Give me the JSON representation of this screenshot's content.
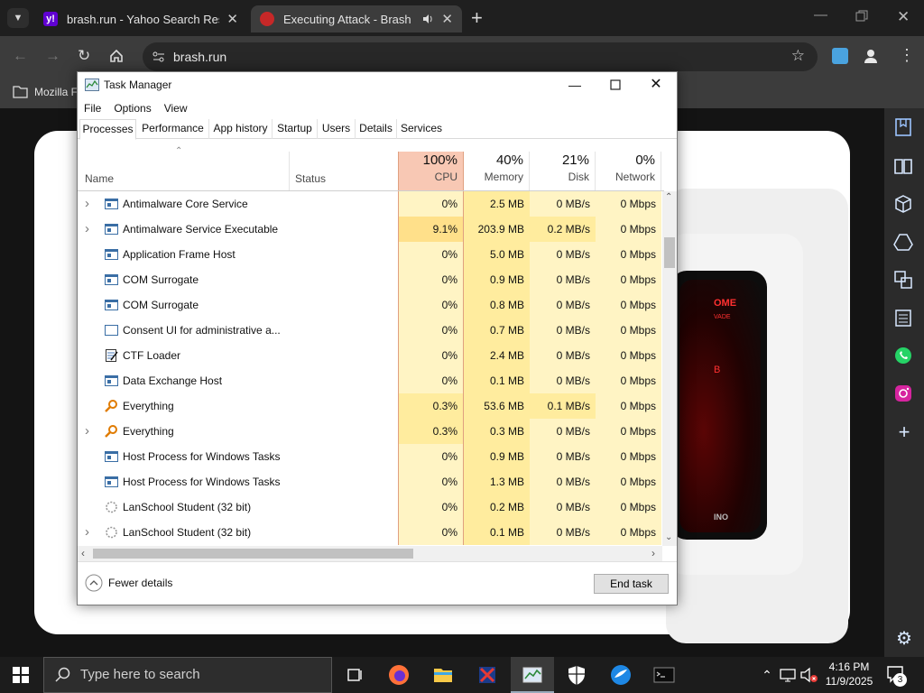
{
  "browser": {
    "tabs": [
      {
        "title": "brash.run - Yahoo Search Results",
        "close": "✕"
      },
      {
        "title": "Executing Attack - Brash",
        "close": "✕"
      }
    ],
    "new_tab": "+",
    "url": "brash.run",
    "bookmark": "Mozilla Firefox"
  },
  "phone_screen": {
    "line1": "OME",
    "line2": "VADE",
    "line3": "B",
    "footer": "INO"
  },
  "task_manager": {
    "title": "Task Manager",
    "menu": [
      "File",
      "Options",
      "View"
    ],
    "tabs": [
      "Processes",
      "Performance",
      "App history",
      "Startup",
      "Users",
      "Details",
      "Services"
    ],
    "columns": {
      "name": "Name",
      "status": "Status",
      "cpu": {
        "pct": "100%",
        "label": "CPU"
      },
      "memory": {
        "pct": "40%",
        "label": "Memory"
      },
      "disk": {
        "pct": "21%",
        "label": "Disk"
      },
      "network": {
        "pct": "0%",
        "label": "Network"
      }
    },
    "processes": [
      {
        "name": "Antimalware Core Service",
        "expandable": true,
        "icon": "window-app-icon",
        "cpu": "0%",
        "memory": "2.5 MB",
        "disk": "0 MB/s",
        "network": "0 Mbps"
      },
      {
        "name": "Antimalware Service Executable",
        "expandable": true,
        "icon": "window-app-icon",
        "cpu": "9.1%",
        "memory": "203.9 MB",
        "disk": "0.2 MB/s",
        "network": "0 Mbps"
      },
      {
        "name": "Application Frame Host",
        "expandable": false,
        "icon": "window-app-icon",
        "cpu": "0%",
        "memory": "5.0 MB",
        "disk": "0 MB/s",
        "network": "0 Mbps"
      },
      {
        "name": "COM Surrogate",
        "expandable": false,
        "icon": "window-app-icon",
        "cpu": "0%",
        "memory": "0.9 MB",
        "disk": "0 MB/s",
        "network": "0 Mbps"
      },
      {
        "name": "COM Surrogate",
        "expandable": false,
        "icon": "window-app-icon",
        "cpu": "0%",
        "memory": "0.8 MB",
        "disk": "0 MB/s",
        "network": "0 Mbps"
      },
      {
        "name": "Consent UI for administrative a...",
        "expandable": false,
        "icon": "blank-window-icon",
        "cpu": "0%",
        "memory": "0.7 MB",
        "disk": "0 MB/s",
        "network": "0 Mbps"
      },
      {
        "name": "CTF Loader",
        "expandable": false,
        "icon": "ctf-notepad-icon",
        "cpu": "0%",
        "memory": "2.4 MB",
        "disk": "0 MB/s",
        "network": "0 Mbps"
      },
      {
        "name": "Data Exchange Host",
        "expandable": false,
        "icon": "window-app-icon",
        "cpu": "0%",
        "memory": "0.1 MB",
        "disk": "0 MB/s",
        "network": "0 Mbps"
      },
      {
        "name": "Everything",
        "expandable": false,
        "icon": "magnifier-icon",
        "cpu": "0.3%",
        "memory": "53.6 MB",
        "disk": "0.1 MB/s",
        "network": "0 Mbps"
      },
      {
        "name": "Everything",
        "expandable": true,
        "icon": "magnifier-icon",
        "cpu": "0.3%",
        "memory": "0.3 MB",
        "disk": "0 MB/s",
        "network": "0 Mbps"
      },
      {
        "name": "Host Process for Windows Tasks",
        "expandable": false,
        "icon": "window-app-icon",
        "cpu": "0%",
        "memory": "0.9 MB",
        "disk": "0 MB/s",
        "network": "0 Mbps"
      },
      {
        "name": "Host Process for Windows Tasks",
        "expandable": false,
        "icon": "window-app-icon",
        "cpu": "0%",
        "memory": "1.3 MB",
        "disk": "0 MB/s",
        "network": "0 Mbps"
      },
      {
        "name": "LanSchool Student (32 bit)",
        "expandable": false,
        "icon": "lanschool-icon",
        "cpu": "0%",
        "memory": "0.2 MB",
        "disk": "0 MB/s",
        "network": "0 Mbps"
      },
      {
        "name": "LanSchool Student (32 bit)",
        "expandable": true,
        "icon": "lanschool-icon",
        "cpu": "0%",
        "memory": "0.1 MB",
        "disk": "0 MB/s",
        "network": "0 Mbps"
      }
    ],
    "fewer_details": "Fewer details",
    "end_task": "End task"
  },
  "taskbar": {
    "search_placeholder": "Type here to search",
    "time": "4:16 PM",
    "date": "11/9/2025",
    "notification_count": "3"
  }
}
